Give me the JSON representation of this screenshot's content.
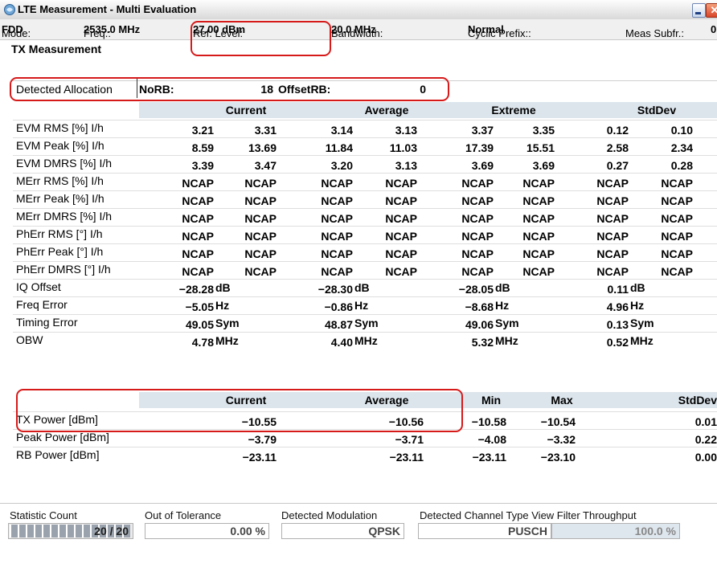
{
  "window": {
    "title": "LTE Measurement",
    "subtitle": "- Multi Evaluation",
    "close_glyph": "✕"
  },
  "mode_bar": {
    "mode_label": "Mode:",
    "mode_value": "FDD",
    "freq_label": "Freq.:",
    "freq_value": "2535.0 MHz",
    "ref_label": "Ref. Level:",
    "ref_value": "27.00 dBm",
    "bw_label": "Bandwidth:",
    "bw_value": "20.0 MHz",
    "cp_label": "Cyclic Prefix::",
    "cp_value": "Normal",
    "subfr_label": "Meas Subfr.:",
    "subfr_value": "0"
  },
  "section_title": "TX Measurement",
  "allocation": {
    "label": "Detected Allocation",
    "norb_label": "NoRB:",
    "norb_value": "18",
    "offset_label": "OffsetRB:",
    "offset_value": "0"
  },
  "header1": [
    "Current",
    "Average",
    "Extreme",
    "StdDev"
  ],
  "rows": [
    {
      "label": "EVM RMS [%] I/h",
      "values": [
        "3.21",
        "3.31",
        "3.14",
        "3.13",
        "3.37",
        "3.35",
        "0.12",
        "0.10"
      ]
    },
    {
      "label": "EVM Peak [%] I/h",
      "values": [
        "8.59",
        "13.69",
        "11.84",
        "11.03",
        "17.39",
        "15.51",
        "2.58",
        "2.34"
      ]
    },
    {
      "label": "EVM DMRS [%] I/h",
      "values": [
        "3.39",
        "3.47",
        "3.20",
        "3.13",
        "3.69",
        "3.69",
        "0.27",
        "0.28"
      ]
    },
    {
      "label": "MErr RMS [%] I/h",
      "values": [
        "NCAP",
        "NCAP",
        "NCAP",
        "NCAP",
        "NCAP",
        "NCAP",
        "NCAP",
        "NCAP"
      ]
    },
    {
      "label": "MErr Peak [%] I/h",
      "values": [
        "NCAP",
        "NCAP",
        "NCAP",
        "NCAP",
        "NCAP",
        "NCAP",
        "NCAP",
        "NCAP"
      ]
    },
    {
      "label": "MErr DMRS [%] I/h",
      "values": [
        "NCAP",
        "NCAP",
        "NCAP",
        "NCAP",
        "NCAP",
        "NCAP",
        "NCAP",
        "NCAP"
      ]
    },
    {
      "label": "PhErr RMS [°] I/h",
      "values": [
        "NCAP",
        "NCAP",
        "NCAP",
        "NCAP",
        "NCAP",
        "NCAP",
        "NCAP",
        "NCAP"
      ]
    },
    {
      "label": "PhErr Peak [°] I/h",
      "values": [
        "NCAP",
        "NCAP",
        "NCAP",
        "NCAP",
        "NCAP",
        "NCAP",
        "NCAP",
        "NCAP"
      ]
    },
    {
      "label": "PhErr DMRS [°] I/h",
      "values": [
        "NCAP",
        "NCAP",
        "NCAP",
        "NCAP",
        "NCAP",
        "NCAP",
        "NCAP",
        "NCAP"
      ]
    }
  ],
  "unit_rows": [
    {
      "label": "IQ Offset",
      "values": [
        "−28.28",
        "−28.30",
        "−28.05",
        "0.11"
      ],
      "unit": "dB"
    },
    {
      "label": "Freq Error",
      "values": [
        "−5.05",
        "−0.86",
        "−8.68",
        "4.96"
      ],
      "unit": "Hz"
    },
    {
      "label": "Timing Error",
      "values": [
        "49.05",
        "48.87",
        "49.06",
        "0.13"
      ],
      "unit": "Sym"
    },
    {
      "label": "OBW",
      "values": [
        "4.78",
        "4.40",
        "5.32",
        "0.52"
      ],
      "unit": "MHz"
    }
  ],
  "header2": [
    "Current",
    "Average",
    "Min",
    "Max",
    "StdDev"
  ],
  "power_rows": [
    {
      "label": "TX Power [dBm]",
      "values": [
        "−10.55",
        "−10.56",
        "−10.58",
        "−10.54",
        "0.01"
      ]
    },
    {
      "label": "Peak Power [dBm]",
      "values": [
        "−3.79",
        "−3.71",
        "−4.08",
        "−3.32",
        "0.22"
      ]
    },
    {
      "label": "RB Power [dBm]",
      "values": [
        "−23.11",
        "−23.11",
        "−23.11",
        "−23.10",
        "0.00"
      ]
    }
  ],
  "footer": {
    "stat_label": "Statistic Count",
    "stat_value": "20 / 20",
    "stat_progress": 1.0,
    "oot_label": "Out of Tolerance",
    "oot_value": "0.00 %",
    "mod_label": "Detected Modulation",
    "mod_value": "QPSK",
    "chan_label": "Detected Channel Type View Filter Throughput",
    "chan_value": "PUSCH",
    "throughput_value": "100.0 %"
  }
}
